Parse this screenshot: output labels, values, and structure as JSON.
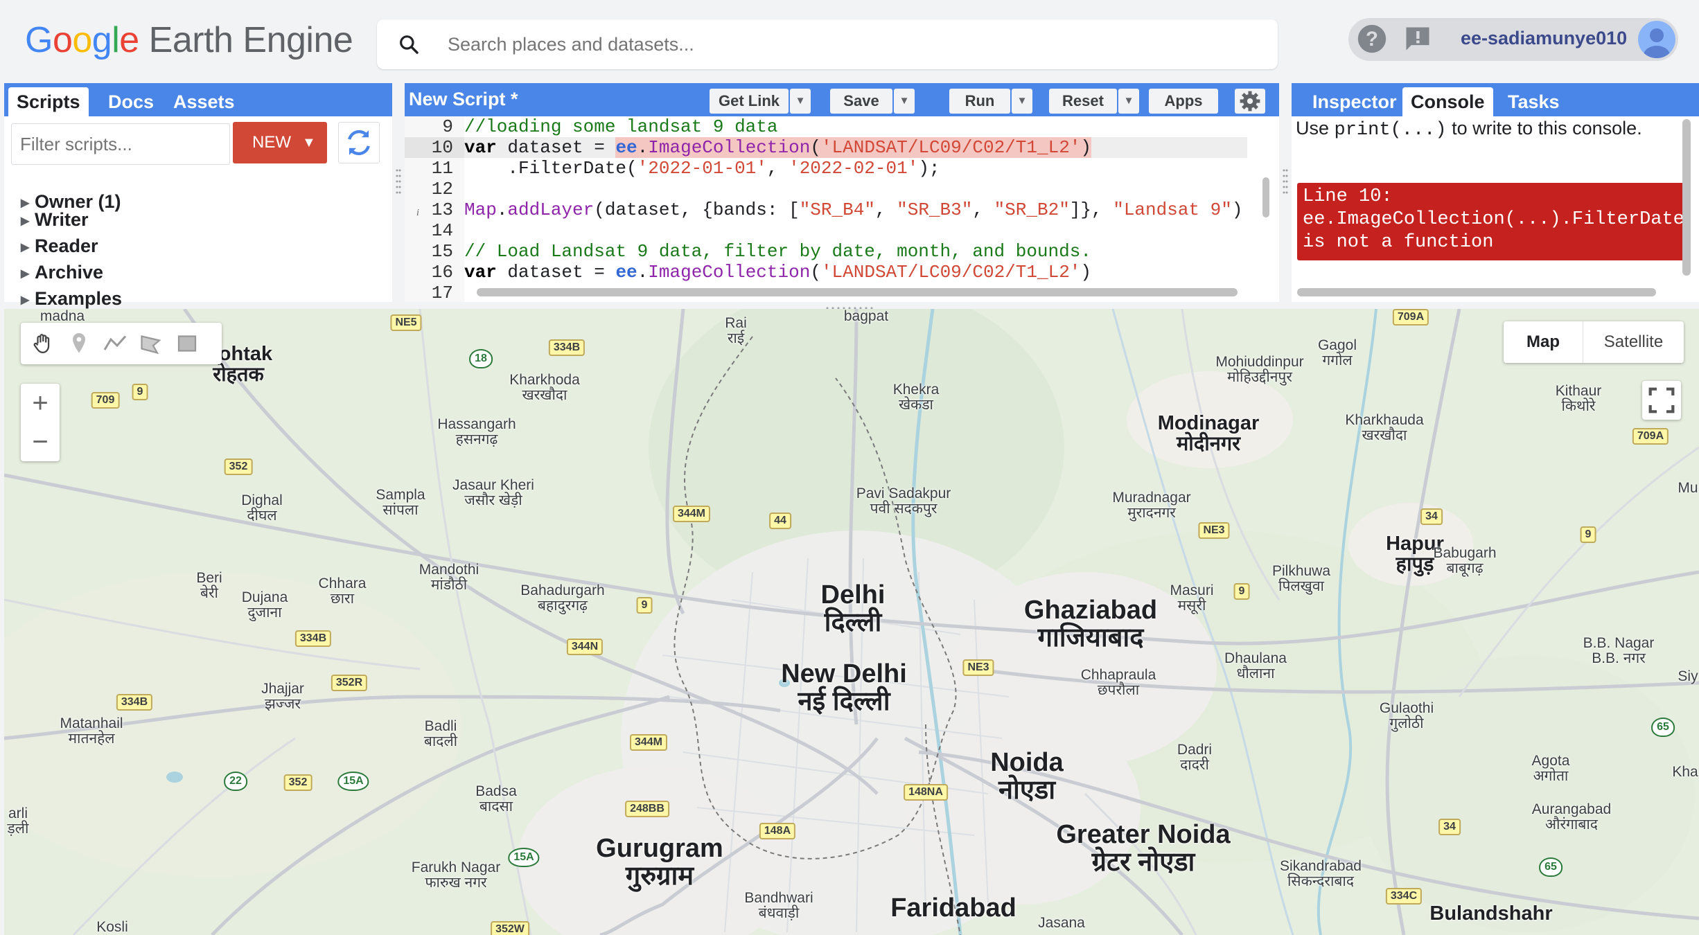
{
  "header": {
    "logo_google": [
      "G",
      "o",
      "o",
      "g",
      "l",
      "e"
    ],
    "logo_product": "Earth Engine",
    "search_placeholder": "Search places and datasets...",
    "user": "ee-sadiamunye010"
  },
  "left_panel": {
    "tabs": [
      "Scripts",
      "Docs",
      "Assets"
    ],
    "active_tab": "Scripts",
    "filter_placeholder": "Filter scripts...",
    "new_label": "NEW",
    "tree": [
      "Owner (1)",
      "Writer",
      "Reader",
      "Archive",
      "Examples"
    ]
  },
  "editor": {
    "title": "New Script *",
    "buttons": {
      "get_link": "Get Link",
      "save": "Save",
      "run": "Run",
      "reset": "Reset",
      "apps": "Apps"
    },
    "line_numbers": [
      "9",
      "10",
      "11",
      "12",
      "13",
      "14",
      "15",
      "16",
      "17"
    ],
    "lines": [
      "//loading some landsat 9 data",
      "var dataset = ee.ImageCollection('LANDSAT/LC09/C02/T1_L2')",
      "    .FilterDate('2022-01-01', '2022-02-01');",
      "",
      "Map.addLayer(dataset, {bands: [\"SR_B4\", \"SR_B3\", \"SR_B2\"]}, \"Landsat 9\")",
      "",
      "// Load Landsat 9 data, filter by date, month, and bounds.",
      "var dataset = ee.ImageCollection('LANDSAT/LC09/C02/T1_L2')",
      ""
    ],
    "highlighted_line": "10"
  },
  "right_panel": {
    "tabs": [
      "Inspector",
      "Console",
      "Tasks"
    ],
    "active_tab": "Console",
    "hint_prefix": "Use ",
    "hint_code": "print(...)",
    "hint_suffix": " to write to this console.",
    "error_lines": [
      "Line 10:",
      "ee.ImageCollection(...).FilterDate",
      "is not a function"
    ]
  },
  "map": {
    "map_type_buttons": [
      "Map",
      "Satellite"
    ],
    "selected_map_type": "Map",
    "zoom_in": "+",
    "zoom_out": "−",
    "places": [
      {
        "name": "Delhi",
        "local": "दिल्ली",
        "size": "md"
      },
      {
        "name": "New Delhi",
        "local": "नई दिल्ली",
        "size": "md"
      },
      {
        "name": "Ghaziabad",
        "local": "गाजियाबाद",
        "size": "md"
      },
      {
        "name": "Noida",
        "local": "नोएडा",
        "size": "md"
      },
      {
        "name": "Greater Noida",
        "local": "ग्रेटर नोएडा",
        "size": "md"
      },
      {
        "name": "Gurugram",
        "local": "गुरुग्राम",
        "size": "md"
      },
      {
        "name": "Faridabad",
        "local": "",
        "size": "md"
      },
      {
        "name": "Modinagar",
        "local": "मोदीनगर",
        "size": "md"
      },
      {
        "name": "Hapur",
        "local": "हापुड़",
        "size": "md"
      },
      {
        "name": "Bulandshahr",
        "local": "",
        "size": "md"
      },
      {
        "name": "Rohtak",
        "local": "रोहतक",
        "size": "md"
      },
      {
        "name": "Kharkhoda",
        "local": "खरखौदा",
        "size": "sm"
      },
      {
        "name": "Hassangarh",
        "local": "हसनगढ़",
        "size": "sm"
      },
      {
        "name": "Jasaur Kheri",
        "local": "जसौर खेड़ी",
        "size": "sm"
      },
      {
        "name": "Sampla",
        "local": "सांपला",
        "size": "sm"
      },
      {
        "name": "Dighal",
        "local": "दीघल",
        "size": "sm"
      },
      {
        "name": "Beri",
        "local": "बेरी",
        "size": "sm"
      },
      {
        "name": "Dujana",
        "local": "दुजाना",
        "size": "sm"
      },
      {
        "name": "Chhara",
        "local": "छारा",
        "size": "sm"
      },
      {
        "name": "Mandothi",
        "local": "मांडौठी",
        "size": "sm"
      },
      {
        "name": "Bahadurgarh",
        "local": "बहादुरगढ़",
        "size": "sm"
      },
      {
        "name": "Jhajjar",
        "local": "झज्जर",
        "size": "sm"
      },
      {
        "name": "Matanhail",
        "local": "मातनहेल",
        "size": "sm"
      },
      {
        "name": "Badli",
        "local": "बादली",
        "size": "sm"
      },
      {
        "name": "Badsa",
        "local": "बादसा",
        "size": "sm"
      },
      {
        "name": "Farukh Nagar",
        "local": "फारुख नगर",
        "size": "sm"
      },
      {
        "name": "Bandhwari",
        "local": "बंधवाड़ी",
        "size": "sm"
      },
      {
        "name": "Kosli",
        "local": "",
        "size": "sm"
      },
      {
        "name": "Rai",
        "local": "राई",
        "size": "sm"
      },
      {
        "name": "Khekra",
        "local": "खेकडा",
        "size": "sm"
      },
      {
        "name": "Pavi Sadakpur",
        "local": "पवी सदकपुर",
        "size": "sm"
      },
      {
        "name": "Mohiuddinpur",
        "local": "मोहिउद्दीनपुर",
        "size": "sm"
      },
      {
        "name": "Gagol",
        "local": "गगोल",
        "size": "sm"
      },
      {
        "name": "Kithaur",
        "local": "किथोरे",
        "size": "sm"
      },
      {
        "name": "Kharkhauda",
        "local": "खरखौदा",
        "size": "sm"
      },
      {
        "name": "Muradnagar",
        "local": "मुरादनगर",
        "size": "sm"
      },
      {
        "name": "Masuri",
        "local": "मसूरी",
        "size": "sm"
      },
      {
        "name": "Pilkhuwa",
        "local": "पिलखुवा",
        "size": "sm"
      },
      {
        "name": "Babugarh",
        "local": "बाबूगढ़",
        "size": "sm"
      },
      {
        "name": "Chhapraula",
        "local": "छपरौला",
        "size": "sm"
      },
      {
        "name": "Dhaulana",
        "local": "धौलाना",
        "size": "sm"
      },
      {
        "name": "B.B. Nagar",
        "local": "B.B. नगर",
        "size": "sm"
      },
      {
        "name": "Gulaothi",
        "local": "गुलोठी",
        "size": "sm"
      },
      {
        "name": "Dadri",
        "local": "दादरी",
        "size": "sm"
      },
      {
        "name": "Agota",
        "local": "अगोता",
        "size": "sm"
      },
      {
        "name": "Aurangabad",
        "local": "औरंगाबाद",
        "size": "sm"
      },
      {
        "name": "Sikandrabad",
        "local": "सिकन्दराबाद",
        "size": "sm"
      },
      {
        "name": "Jasana",
        "local": "",
        "size": "sm"
      },
      {
        "name": "bagpat",
        "local": "",
        "size": "sm"
      },
      {
        "name": "madna",
        "local": "",
        "size": "sm"
      },
      {
        "name": "Kha",
        "local": "",
        "size": "sm"
      },
      {
        "name": "Mu",
        "local": "",
        "size": "sm"
      },
      {
        "name": "Siy",
        "local": "",
        "size": "sm"
      },
      {
        "name": "arli",
        "local": "ड़ली",
        "size": "sm"
      }
    ],
    "road_shields": [
      "NE5",
      "334B",
      "18",
      "9",
      "709",
      "352",
      "344M",
      "44",
      "9",
      "344N",
      "334B",
      "352R",
      "334B",
      "344M",
      "22",
      "352",
      "15A",
      "248BB",
      "148A",
      "15A",
      "352W",
      "148NA",
      "NE3",
      "NE3",
      "9",
      "34",
      "9",
      "709A",
      "709A",
      "65",
      "34",
      "65",
      "334C"
    ]
  }
}
